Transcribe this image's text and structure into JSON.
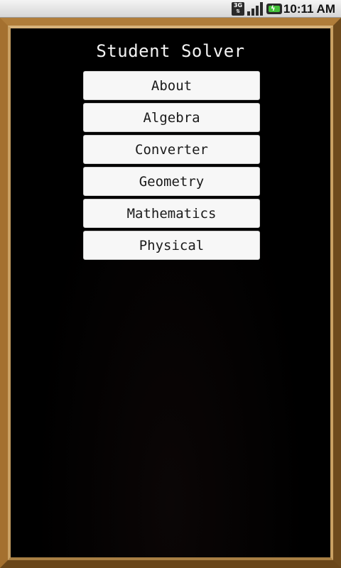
{
  "status_bar": {
    "network": "3G",
    "time": "10:11 AM",
    "icons": [
      "3g-data-icon",
      "signal-icon",
      "battery-charging-icon"
    ]
  },
  "app": {
    "title": "Student Solver",
    "menu": [
      {
        "label": "About"
      },
      {
        "label": "Algebra"
      },
      {
        "label": "Converter"
      },
      {
        "label": "Geometry"
      },
      {
        "label": "Mathematics"
      },
      {
        "label": "Physical"
      }
    ]
  },
  "colors": {
    "board": "#000000",
    "frame": "#8a5f25",
    "button_bg": "#f7f7f7",
    "title_text": "#f2f2f2"
  }
}
